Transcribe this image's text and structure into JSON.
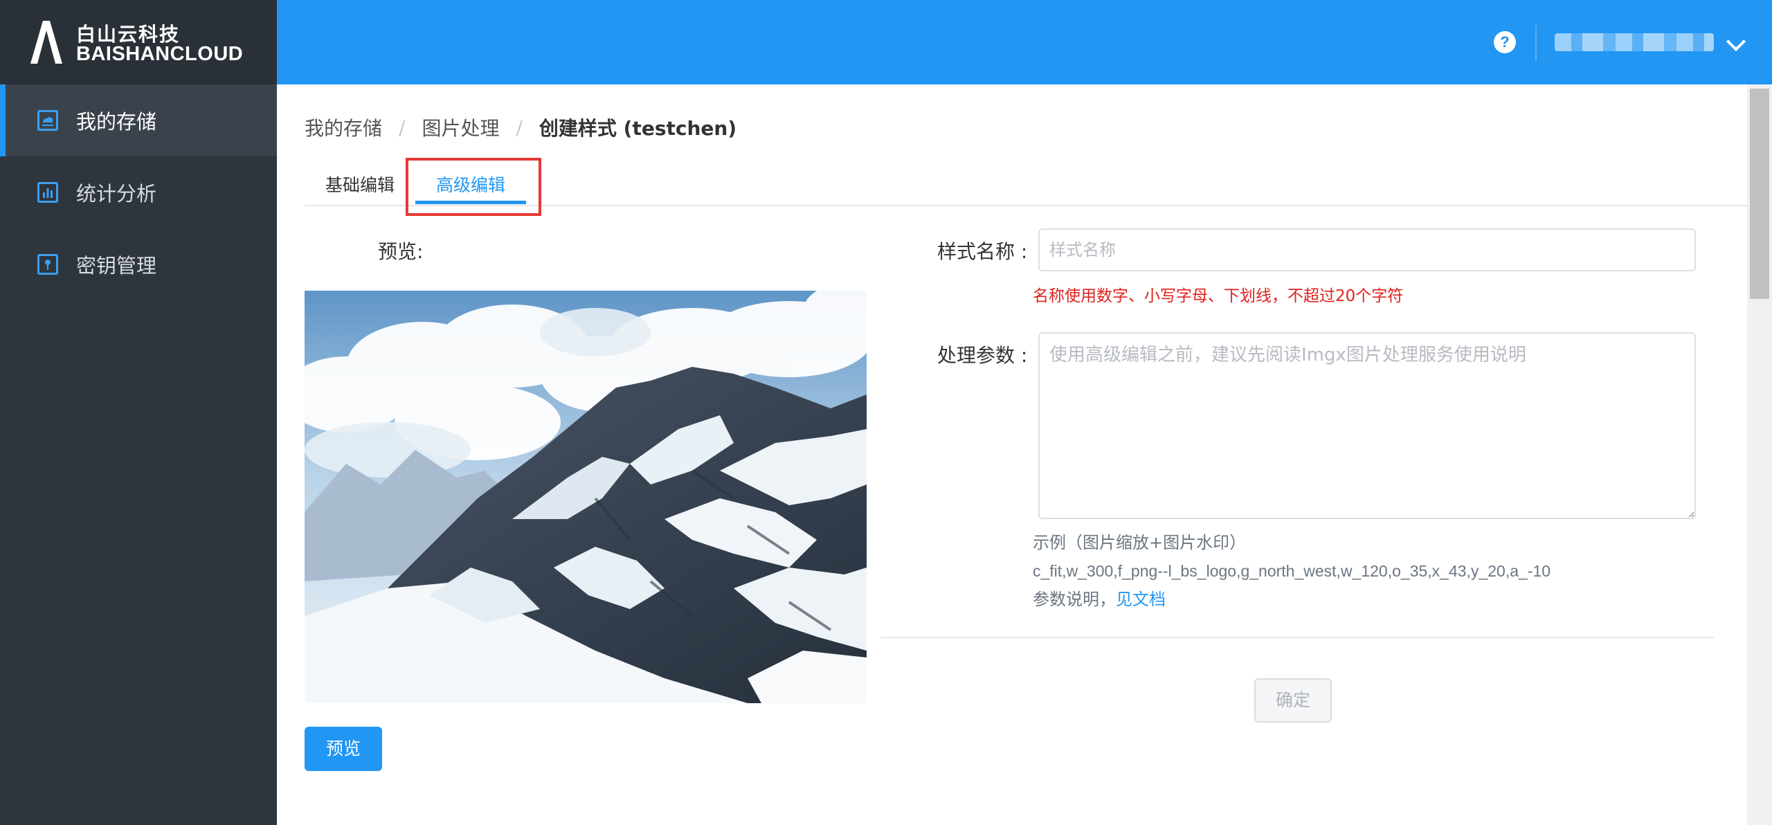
{
  "brand": {
    "name_cn": "白山云科技",
    "name_en": "BAISHANCLOUD"
  },
  "sidebar": {
    "items": [
      {
        "label": "我的存储",
        "icon": "storage-icon",
        "active": true
      },
      {
        "label": "统计分析",
        "icon": "bar-chart-icon",
        "active": false
      },
      {
        "label": "密钥管理",
        "icon": "key-icon",
        "active": false
      }
    ]
  },
  "header": {
    "help_icon": "?"
  },
  "breadcrumb": {
    "items": [
      "我的存储",
      "图片处理"
    ],
    "current": "创建样式 (testchen)",
    "separator": "/"
  },
  "tabs": {
    "basic": "基础编辑",
    "advanced": "高级编辑",
    "active": "advanced"
  },
  "preview": {
    "label": "预览:",
    "button": "预览"
  },
  "form": {
    "name_label": "样式名称 :",
    "name_placeholder": "样式名称",
    "name_value": "",
    "name_hint": "名称使用数字、小写字母、下划线，不超过20个字符",
    "params_label": "处理参数 :",
    "params_placeholder": "使用高级编辑之前，建议先阅读Imgx图片处理服务使用说明",
    "params_value": "",
    "example_title": "示例（图片缩放+图片水印）",
    "example_code": "c_fit,w_300,f_png--l_bs_logo,g_north_west,w_120,o_35,x_43,y_20,a_-10",
    "param_doc_prefix": "参数说明，",
    "param_doc_link": "见文档"
  },
  "actions": {
    "confirm": "确定"
  },
  "colors": {
    "primary": "#2196f3",
    "sidebar_bg": "#2e353d",
    "error": "#e0211d",
    "highlight": "#e53935"
  }
}
